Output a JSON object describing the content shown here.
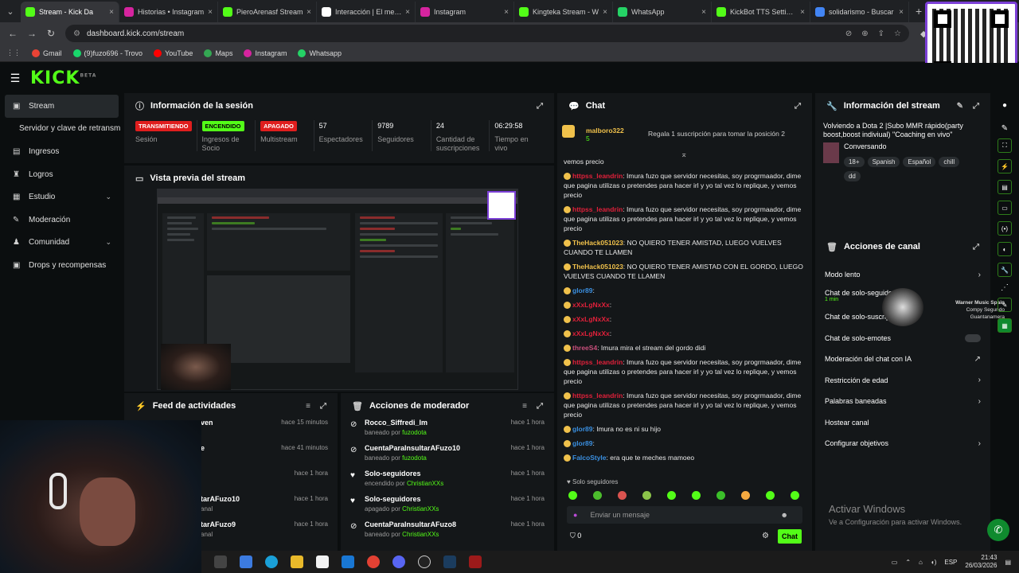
{
  "browser": {
    "tabs": [
      {
        "title": "Stream - Kick Da",
        "color": "#53fc18",
        "active": true
      },
      {
        "title": "Historias • Instagram",
        "color": "#d6249f"
      },
      {
        "title": "PieroArenasf Stream",
        "color": "#53fc18"
      },
      {
        "title": "Interacción | El mejor",
        "color": "#ffffff"
      },
      {
        "title": "Instagram",
        "color": "#d6249f"
      },
      {
        "title": "Kingteka Stream - W",
        "color": "#53fc18"
      },
      {
        "title": "WhatsApp",
        "color": "#25d366"
      },
      {
        "title": "KickBot TTS Settings",
        "color": "#53fc18"
      },
      {
        "title": "solidarismo - Buscar",
        "color": "#4285f4"
      }
    ],
    "url": "dashboard.kick.com/stream",
    "bookmarks": [
      {
        "label": "Gmail",
        "color": "#ea4335"
      },
      {
        "label": "(9)fuzo696 - Trovo",
        "color": "#19d66b"
      },
      {
        "label": "YouTube",
        "color": "#ff0000"
      },
      {
        "label": "Maps",
        "color": "#34a853"
      },
      {
        "label": "Instagram",
        "color": "#d6249f"
      },
      {
        "label": "Whatsapp",
        "color": "#25d366"
      }
    ]
  },
  "kick": {
    "logo": "KICK",
    "logo_sup": "BETA",
    "sidebar": [
      {
        "label": "Stream",
        "icon": "video-icon",
        "glyph": "▣",
        "active": true
      },
      {
        "label": "Servidor y clave de retransm",
        "icon": "",
        "glyph": "",
        "sub": true
      },
      {
        "label": "Ingresos",
        "icon": "money-icon",
        "glyph": "▤"
      },
      {
        "label": "Logros",
        "icon": "trophy-icon",
        "glyph": "♜"
      },
      {
        "label": "Estudio",
        "icon": "studio-icon",
        "glyph": "▦",
        "chevron": true
      },
      {
        "label": "Moderación",
        "icon": "sword-icon",
        "glyph": "✎"
      },
      {
        "label": "Comunidad",
        "icon": "community-icon",
        "glyph": "♟",
        "chevron": true
      },
      {
        "label": "Drops y recompensas",
        "icon": "gift-icon",
        "glyph": "▣"
      }
    ],
    "session": {
      "title": "Información de la sesión",
      "stats": [
        {
          "pill": "TRANSMITIENDO",
          "pill_color": "red",
          "label": "Sesión"
        },
        {
          "pill": "ENCENDIDO",
          "pill_color": "green",
          "label": "Ingresos de Socio"
        },
        {
          "pill": "APAGADO",
          "pill_color": "red",
          "label": "Multistream"
        },
        {
          "value": "57",
          "label": "Espectadores"
        },
        {
          "value": "9789",
          "label": "Seguidores"
        },
        {
          "value": "24",
          "label": "Cantidad de suscripciones"
        },
        {
          "value": "06:29:58",
          "label": "Tiempo en vivo"
        }
      ]
    },
    "preview": {
      "title": "Vista previa del stream"
    },
    "feed": {
      "title": "Feed de actividades",
      "rows": [
        {
          "name": "ven",
          "time": "hace 15 minutos"
        },
        {
          "name": "e",
          "time": "hace 41 minutos"
        },
        {
          "name": "",
          "time": "hace 1 hora"
        },
        {
          "name": "tarAFuzo10",
          "sub": "anal",
          "time": "hace 1 hora"
        },
        {
          "name": "tarAFuzo9",
          "sub": "anal",
          "time": "hace 1 hora"
        }
      ]
    },
    "modactions": {
      "title": "Acciones de moderador",
      "rows": [
        {
          "icon": "ban-icon",
          "glyph": "⊘",
          "title": "Rocco_Siffredi_Im",
          "sub": "baneado por",
          "user": "fuzodota",
          "time": "hace 1 hora"
        },
        {
          "icon": "ban-icon",
          "glyph": "⊘",
          "title": "CuentaParaInsultarAFuzo10",
          "sub": "baneado por",
          "user": "fuzodota",
          "time": "hace 1 hora"
        },
        {
          "icon": "heart-icon",
          "glyph": "♥",
          "title": "Solo-seguidores",
          "sub": "encendido por",
          "user": "ChristianXXs",
          "time": "hace 1 hora"
        },
        {
          "icon": "heart-icon",
          "glyph": "♥",
          "title": "Solo-seguidores",
          "sub": "apagado por",
          "user": "ChristianXXs",
          "time": "hace 1 hora"
        },
        {
          "icon": "ban-icon",
          "glyph": "⊘",
          "title": "CuentaParaInsultarAFuzo8",
          "sub": "baneado por",
          "user": "ChristianXXs",
          "time": "hace 1 hora"
        }
      ]
    },
    "chat": {
      "title": "Chat",
      "pinned_user": "malboro322",
      "pinned_count": "5",
      "pinned_text": "Regala 1 suscripción para tomar la posición 2",
      "messages": [
        {
          "name": "",
          "text": "vemos precio",
          "color": "#e8e8e8"
        },
        {
          "name": "httpss_leandrin",
          "text": ": Imura fuzo que servidor necesitas, soy progrmaador, dime que pagina utilizas o pretendes para hacer irl y yo tal vez lo replique, y vemos precio",
          "color": "#e0203a"
        },
        {
          "name": "httpss_leandrin",
          "text": ": Imura fuzo que servidor necesitas, soy progrmaador, dime que pagina utilizas o pretendes para hacer irl y yo tal vez lo replique, y vemos precio",
          "color": "#e0203a"
        },
        {
          "name": "TheHack051023",
          "text": ": NO QUIERO TENER AMISTAD, LUEGO VUELVES CUANDO TE LLAMEN",
          "color": "#f0c14b"
        },
        {
          "name": "TheHack051023",
          "text": ": NO QUIERO TENER AMISTAD CON EL GORDO, LUEGO VUELVES CUANDO TE LLAMEN",
          "color": "#f0c14b"
        },
        {
          "name": "glor89",
          "text": ":",
          "color": "#3a8fe0"
        },
        {
          "name": "xXxLgNxXx",
          "text": ":",
          "color": "#e0203a"
        },
        {
          "name": "xXxLgNxXx",
          "text": ":",
          "color": "#e0203a"
        },
        {
          "name": "xXxLgNxXx",
          "text": ":",
          "color": "#e0203a"
        },
        {
          "name": "threeS4",
          "text": ": Imura mira el stream del gordo didi",
          "color": "#c94f7c"
        },
        {
          "name": "httpss_leandrin",
          "text": ": Imura fuzo que servidor necesitas, soy progrmaador, dime que pagina utilizas o pretendes para hacer irl y yo tal vez lo replique, y vemos precio",
          "color": "#e0203a"
        },
        {
          "name": "httpss_leandrin",
          "text": ": Imura fuzo que servidor necesitas, soy progrmaador, dime que pagina utilizas o pretendes para hacer irl y yo tal vez lo replique, y vemos precio",
          "color": "#e0203a"
        },
        {
          "name": "glor89",
          "text": ": Imura no es ni su hijo",
          "color": "#3a8fe0"
        },
        {
          "name": "glor89",
          "text": ":",
          "color": "#3a8fe0"
        },
        {
          "name": "FalcoStyle",
          "text": ": era que te meches mamoeo",
          "color": "#3a8fe0"
        }
      ],
      "followers_only": "Solo seguidores",
      "placeholder": "Enviar un mensaje",
      "count": "0",
      "send": "Chat"
    },
    "streaminfo": {
      "title": "Información del stream",
      "stream_title": "Volviendo a Dota 2 |Subo MMR rápido(party boost,boost indiviual) \"Coaching en vivo\"",
      "category": "Conversando",
      "tags": [
        "18+",
        "Spanish",
        "Español",
        "chill",
        "dd"
      ]
    },
    "channel": {
      "title": "Acciones de canal",
      "items": [
        {
          "label": "Modo lento",
          "control": "›"
        },
        {
          "label": "Chat de solo-seguidores",
          "sub": "1 min",
          "control": ""
        },
        {
          "label": "Chat de solo-suscriptores",
          "control": ""
        },
        {
          "label": "Chat de solo-emotes",
          "control": "toggle"
        },
        {
          "label": "Moderación del chat con IA",
          "control": "↗"
        },
        {
          "label": "Restricción de edad",
          "control": "›"
        },
        {
          "label": "Palabras baneadas",
          "control": "›"
        },
        {
          "label": "Hostear canal",
          "control": ""
        },
        {
          "label": "Configurar objetivos",
          "control": "›"
        }
      ]
    },
    "overlay_music": {
      "line1": "Warner Music Spain",
      "line2": "Compy Segundo Guantanamera"
    }
  },
  "windows": {
    "activate_title": "Activar Windows",
    "activate_sub": "Ve a Configuración para activar Windows.",
    "lang": "ESP",
    "time": "21:43",
    "date": "26/03/2026"
  }
}
